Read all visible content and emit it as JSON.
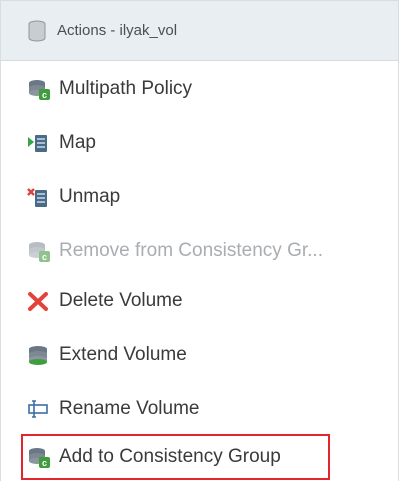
{
  "header": {
    "icon": "storage-stack-icon",
    "title": "Actions - ilyak_vol"
  },
  "menu": {
    "items": [
      {
        "label": "Multipath Policy",
        "icon": "storage-policy-icon",
        "disabled": false
      },
      {
        "label": "Map",
        "icon": "map-volume-icon",
        "disabled": false
      },
      {
        "label": "Unmap",
        "icon": "unmap-volume-icon",
        "disabled": false
      },
      {
        "label": "Remove from Consistency Gr...",
        "icon": "consistency-group-remove-icon",
        "disabled": true
      },
      {
        "label": "Delete Volume",
        "icon": "delete-x-icon",
        "disabled": false
      },
      {
        "label": "Extend Volume",
        "icon": "extend-storage-icon",
        "disabled": false
      },
      {
        "label": "Rename Volume",
        "icon": "rename-icon",
        "disabled": false
      },
      {
        "label": "Add to Consistency Group",
        "icon": "consistency-group-add-icon",
        "disabled": false,
        "highlighted": true
      }
    ]
  },
  "colors": {
    "highlight_border": "#e3262d",
    "header_bg": "#e9eef2",
    "disabled_text": "#a9adb1"
  }
}
